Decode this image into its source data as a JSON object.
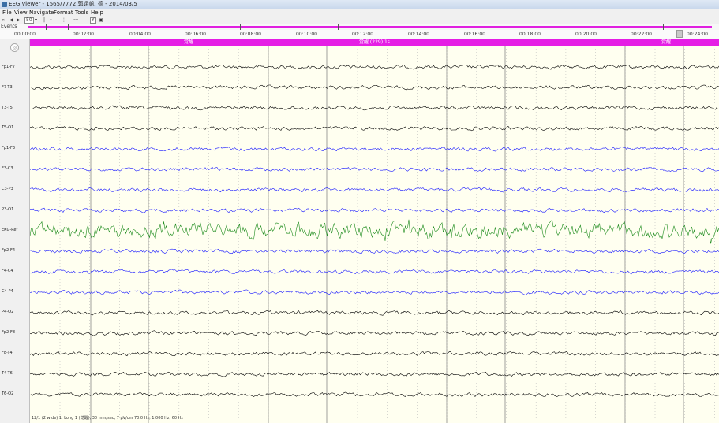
{
  "window": {
    "title": "EEG Viewer - 1565/7772 郭翊帆, 德 - 2014/03/5"
  },
  "menu": [
    "File",
    "View",
    "Navigate",
    "Format",
    "Tools",
    "Help"
  ],
  "toolbar": {
    "sensitivity": "50",
    "marker": "Y"
  },
  "events_label": "Events",
  "time_labels": [
    "00:00:00",
    "00:02:00",
    "00:04:00",
    "00:06:00",
    "00:08:00",
    "00:10:00",
    "00:12:00",
    "00:14:00",
    "00:16:00",
    "00:18:00",
    "00:20:00",
    "00:22:00",
    "00:24:00"
  ],
  "event_banner": {
    "center_label": "觉醒 (229) 1s",
    "left_label": "觉醒",
    "right_label": "觉醒"
  },
  "channels": [
    {
      "label": "Fp1-F7",
      "color": "#000000"
    },
    {
      "label": "F7-T3",
      "color": "#000000"
    },
    {
      "label": "T3-T5",
      "color": "#000000"
    },
    {
      "label": "T5-O1",
      "color": "#000000"
    },
    {
      "label": "Fp1-F3",
      "color": "#1a1aff"
    },
    {
      "label": "F3-C3",
      "color": "#1a1aff"
    },
    {
      "label": "C3-P3",
      "color": "#1a1aff"
    },
    {
      "label": "P3-O1",
      "color": "#1a1aff"
    },
    {
      "label": "EKG-Ref",
      "color": "#1a8a1a"
    },
    {
      "label": "Fp2-F4",
      "color": "#1a1aff"
    },
    {
      "label": "F4-C4",
      "color": "#1a1aff"
    },
    {
      "label": "C4-P4",
      "color": "#1a1aff"
    },
    {
      "label": "P4-O2",
      "color": "#000000"
    },
    {
      "label": "Fp2-F8",
      "color": "#000000"
    },
    {
      "label": "F8-T4",
      "color": "#000000"
    },
    {
      "label": "T4-T6",
      "color": "#000000"
    },
    {
      "label": "T6-O2",
      "color": "#000000"
    }
  ],
  "status_text": "12/1 (2 wide) 1. Long 1 (觉醒), 30 mm/sec, 7 µV/cm 70.0 Hz, 1.000 Hz, 60 Hz"
}
